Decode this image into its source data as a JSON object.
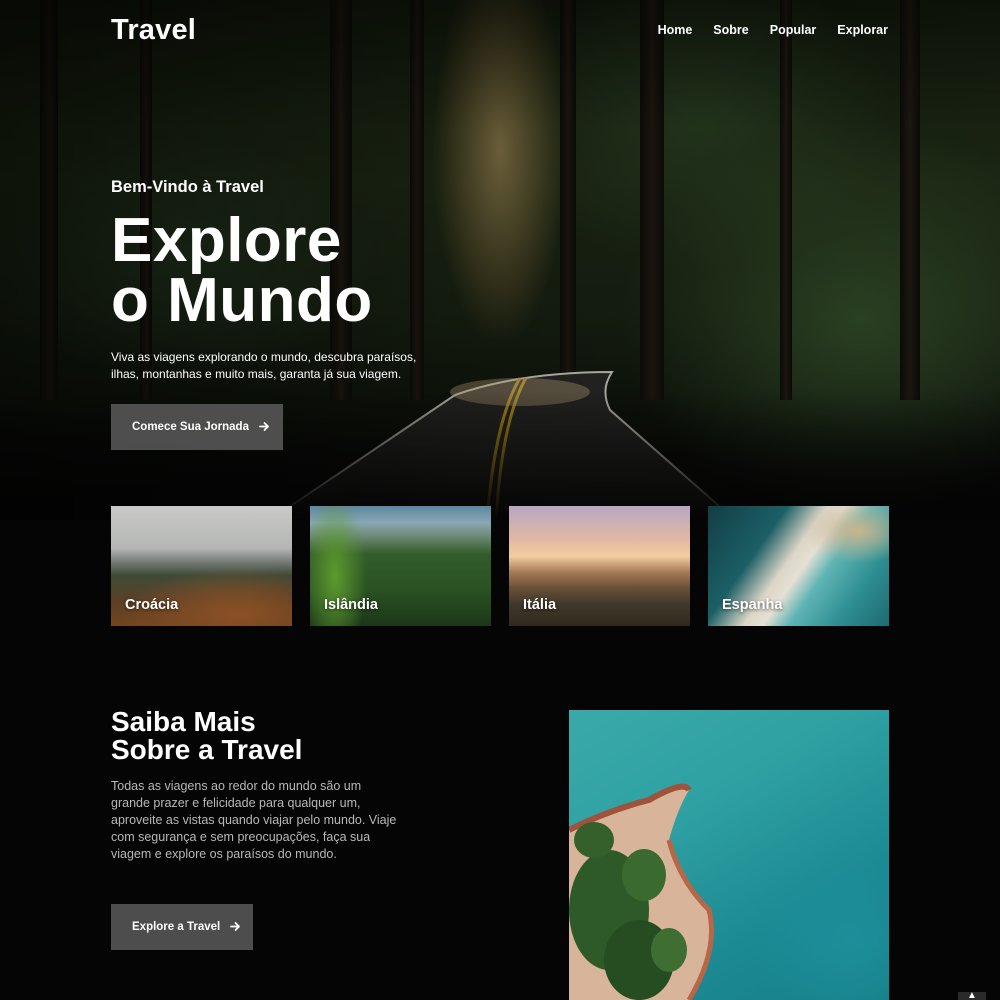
{
  "brand": "Travel",
  "nav": {
    "links": [
      "Home",
      "Sobre",
      "Popular",
      "Explorar"
    ]
  },
  "hero": {
    "kicker": "Bem-Vindo à Travel",
    "title_line1": "Explore",
    "title_line2": "o Mundo",
    "description": "Viva as viagens explorando o mundo, descubra paraísos, ilhas, montanhas e muito mais, garanta já sua viagem.",
    "button_label": "Comece Sua Jornada"
  },
  "destinations": [
    {
      "name": "Croácia"
    },
    {
      "name": "Islândia"
    },
    {
      "name": "Itália"
    },
    {
      "name": "Espanha"
    }
  ],
  "about": {
    "title_line1": "Saiba Mais",
    "title_line2": "Sobre a Travel",
    "description": "Todas as viagens ao redor do mundo são um grande prazer e felicidade para qualquer um, aproveite as vistas quando viajar pelo mundo. Viaje com segurança e sem preocupações, faça sua viagem e explore os paraísos do mundo.",
    "button_label": "Explore a Travel"
  },
  "icons": {
    "button_arrow": "arrow-right-icon",
    "scroll_top": "chevron-up-icon"
  },
  "colors": {
    "background": "#050505",
    "button": "#5a5a5a",
    "text": "#ffffff",
    "muted_text": "#b8b8b8"
  }
}
